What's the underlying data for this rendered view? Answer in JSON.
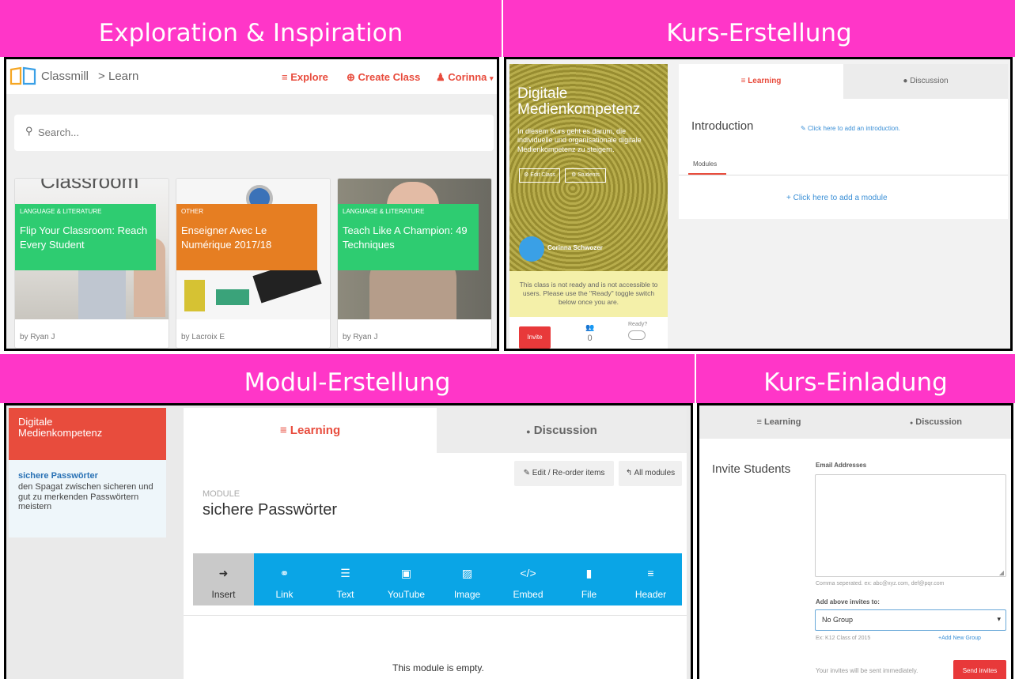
{
  "panels": {
    "p1": {
      "label": "Exploration & Inspiration"
    },
    "p2": {
      "label": "Kurs-Erstellung"
    },
    "p3": {
      "label": "Modul-Erstellung"
    },
    "p4": {
      "label": "Kurs-Einladung"
    }
  },
  "explore": {
    "logo_text": "Classmill",
    "breadcrumb_sep": ">",
    "breadcrumb_page": "Learn",
    "nav": {
      "explore": "Explore",
      "create_class": "Create Class",
      "user": "Corinna"
    },
    "search_placeholder": "Search...",
    "cards": [
      {
        "category": "LANGUAGE & LITERATURE",
        "title": "Flip Your Classroom: Reach Every Student",
        "author": "by Ryan J",
        "ribbon_color": "#2ecc71",
        "bg_text": "Classroom"
      },
      {
        "category": "OTHER",
        "title": "Enseigner Avec Le Numérique 2017/18",
        "author": "by Lacroix E",
        "ribbon_color": "#e67e22"
      },
      {
        "category": "LANGUAGE & LITERATURE",
        "title": "Teach Like A Champion: 49 Techniques",
        "author": "by Ryan J",
        "ribbon_color": "#2ecc71"
      }
    ]
  },
  "course": {
    "title": "Digitale Medienkompetenz",
    "description": "In diesem Kurs geht es darum, die individuelle und organisationale digitale Medienkompetenz zu steigern.",
    "edit_class": "Edit Class",
    "students": "Students",
    "author": "Corinna Schwozer",
    "notice": "This class is not ready and is not accessible to users. Please use the \"Ready\" toggle switch below once you are.",
    "invite": "Invite",
    "student_count": "0",
    "ready_label": "Ready?",
    "tab_learning": "Learning",
    "tab_discussion": "Discussion",
    "intro_title": "Introduction",
    "intro_link": "Click here to add an introduction.",
    "modules_tab": "Modules",
    "add_module": "Click here to add a module"
  },
  "module": {
    "sidebar_title": "Digitale Medienkompetenz",
    "item_title": "sichere Passwörter",
    "item_desc": "den Spagat zwischen sicheren und gut zu merkenden Passwörtern meistern",
    "tab_learning": "Learning",
    "tab_discussion": "Discussion",
    "edit_btn": "Edit / Re-order items",
    "all_modules": "All modules",
    "overline": "MODULE",
    "title": "sichere Passwörter",
    "tools": [
      {
        "label": "Insert",
        "icon": "➜"
      },
      {
        "label": "Link",
        "icon": "⚭"
      },
      {
        "label": "Text",
        "icon": "☰"
      },
      {
        "label": "YouTube",
        "icon": "▣"
      },
      {
        "label": "Image",
        "icon": "▨"
      },
      {
        "label": "Embed",
        "icon": "</>"
      },
      {
        "label": "File",
        "icon": "▮"
      },
      {
        "label": "Header",
        "icon": "≡"
      }
    ],
    "empty": "This module is empty."
  },
  "invite": {
    "tab_learning": "Learning",
    "tab_discussion": "Discussion",
    "heading": "Invite Students",
    "email_label": "Email Addresses",
    "email_hint": "Comma seperated. ex: abc@xyz.com, def@pqr.com",
    "group_label": "Add above invites to:",
    "group_value": "No Group",
    "group_hint": "Ex: K12 Class of 2015",
    "add_group": "Add New Group",
    "send_note": "Your invites will be sent immediately.",
    "send_btn": "Send invites"
  },
  "colors": {
    "accent": "#e84c3d",
    "band": "#ff36c8",
    "toolbar": "#0aa5e6",
    "green": "#2ecc71",
    "orange": "#e67e22"
  }
}
